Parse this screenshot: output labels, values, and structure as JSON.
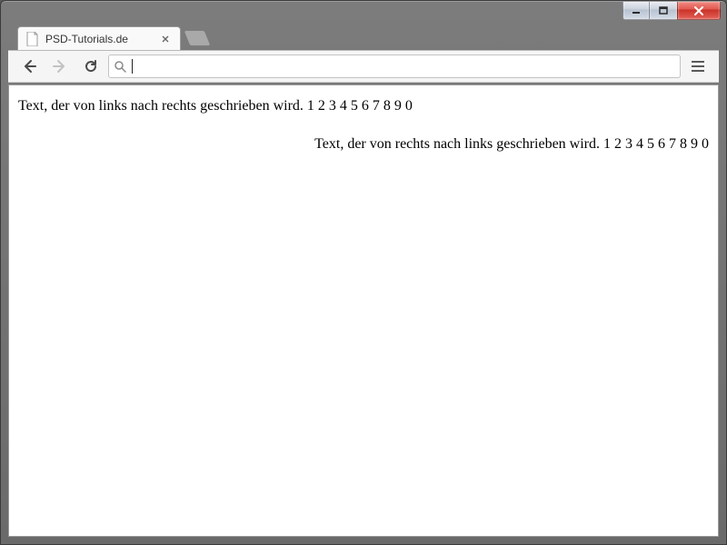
{
  "window": {
    "minimize_tooltip": "Minimize",
    "maximize_tooltip": "Maximize",
    "close_tooltip": "Close"
  },
  "tab": {
    "title": "PSD-Tutorials.de"
  },
  "toolbar": {
    "url": "",
    "placeholder": ""
  },
  "page": {
    "line_ltr": "Text, der von links nach rechts geschrieben wird. 1 2 3 4 5 6 7 8 9 0",
    "line_rtl": "Text, der von rechts nach links geschrieben wird. 1 2 3 4 5 6 7 8 9 0"
  }
}
